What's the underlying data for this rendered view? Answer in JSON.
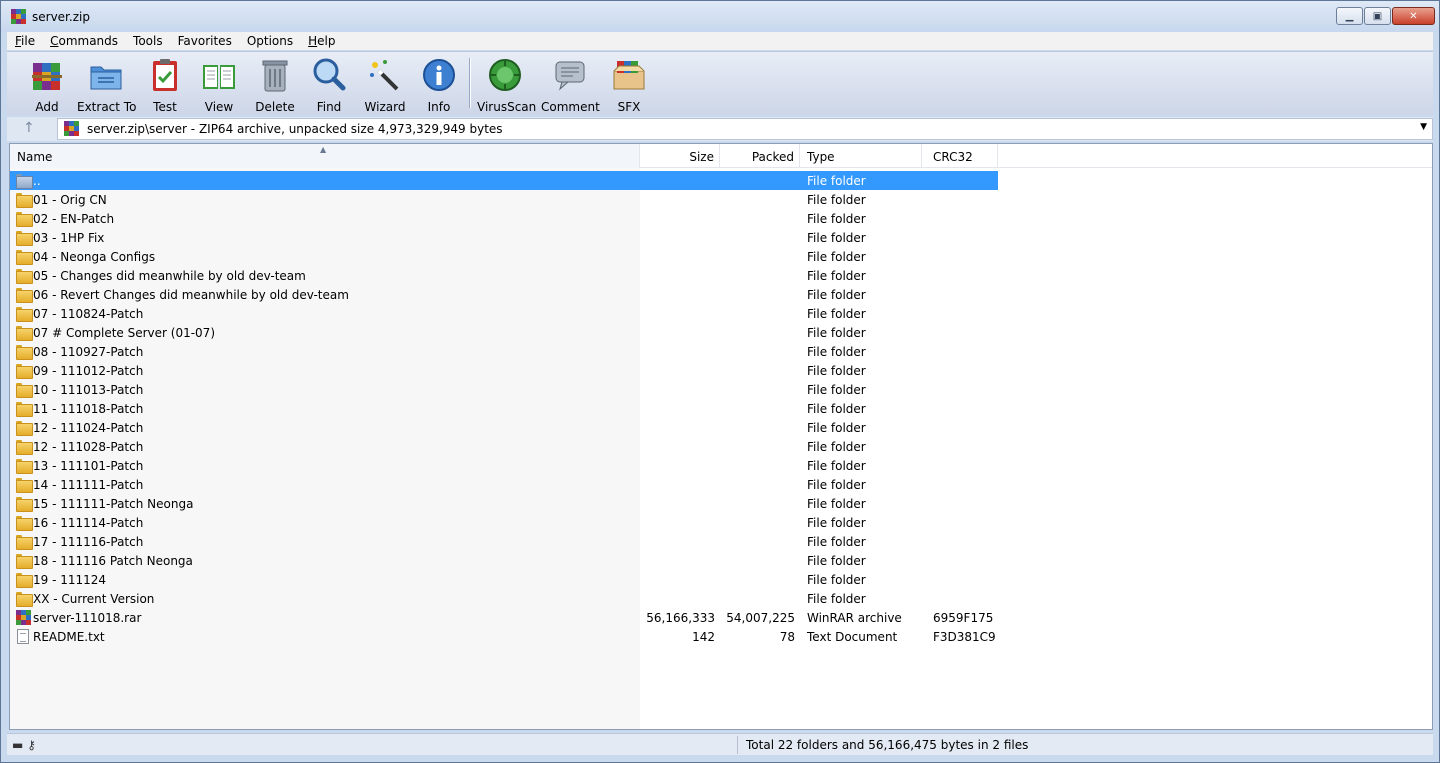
{
  "window": {
    "title": "server.zip"
  },
  "menu": [
    {
      "label": "File",
      "u": "F",
      "rest": "ile"
    },
    {
      "label": "Commands",
      "u": "C",
      "rest": "ommands"
    },
    {
      "label": "Tools",
      "u": "",
      "rest": "Tools"
    },
    {
      "label": "Favorites",
      "u": "",
      "rest": "Favorites"
    },
    {
      "label": "Options",
      "u": "",
      "rest": "Options"
    },
    {
      "label": "Help",
      "u": "H",
      "rest": "elp"
    }
  ],
  "toolbar": {
    "add": "Add",
    "extract": "Extract To",
    "test": "Test",
    "view": "View",
    "delete": "Delete",
    "find": "Find",
    "wizard": "Wizard",
    "info": "Info",
    "virusscan": "VirusScan",
    "comment": "Comment",
    "sfx": "SFX"
  },
  "address": {
    "path": "server.zip\\server - ZIP64 archive, unpacked size 4,973,329,949 bytes"
  },
  "columns": {
    "name": "Name",
    "size": "Size",
    "packed": "Packed",
    "type": "Type",
    "crc": "CRC32"
  },
  "files": [
    {
      "name": "..",
      "size": "",
      "packed": "",
      "type": "File folder",
      "crc": "",
      "icon": "up-folder-icon"
    },
    {
      "name": "01 - Orig CN",
      "size": "",
      "packed": "",
      "type": "File folder",
      "crc": "",
      "icon": "folder-icon"
    },
    {
      "name": "02 - EN-Patch",
      "size": "",
      "packed": "",
      "type": "File folder",
      "crc": "",
      "icon": "folder-icon"
    },
    {
      "name": "03 - 1HP Fix",
      "size": "",
      "packed": "",
      "type": "File folder",
      "crc": "",
      "icon": "folder-icon"
    },
    {
      "name": "04 - Neonga Configs",
      "size": "",
      "packed": "",
      "type": "File folder",
      "crc": "",
      "icon": "folder-icon"
    },
    {
      "name": "05 - Changes did meanwhile by old dev-team",
      "size": "",
      "packed": "",
      "type": "File folder",
      "crc": "",
      "icon": "folder-icon"
    },
    {
      "name": "06 - Revert Changes did meanwhile by old dev-team",
      "size": "",
      "packed": "",
      "type": "File folder",
      "crc": "",
      "icon": "folder-icon"
    },
    {
      "name": "07 - 110824-Patch",
      "size": "",
      "packed": "",
      "type": "File folder",
      "crc": "",
      "icon": "folder-icon"
    },
    {
      "name": "07 # Complete Server (01-07)",
      "size": "",
      "packed": "",
      "type": "File folder",
      "crc": "",
      "icon": "folder-icon"
    },
    {
      "name": "08 - 110927-Patch",
      "size": "",
      "packed": "",
      "type": "File folder",
      "crc": "",
      "icon": "folder-icon"
    },
    {
      "name": "09 - 111012-Patch",
      "size": "",
      "packed": "",
      "type": "File folder",
      "crc": "",
      "icon": "folder-icon"
    },
    {
      "name": "10 - 111013-Patch",
      "size": "",
      "packed": "",
      "type": "File folder",
      "crc": "",
      "icon": "folder-icon"
    },
    {
      "name": "11 - 111018-Patch",
      "size": "",
      "packed": "",
      "type": "File folder",
      "crc": "",
      "icon": "folder-icon"
    },
    {
      "name": "12 - 111024-Patch",
      "size": "",
      "packed": "",
      "type": "File folder",
      "crc": "",
      "icon": "folder-icon"
    },
    {
      "name": "12 - 111028-Patch",
      "size": "",
      "packed": "",
      "type": "File folder",
      "crc": "",
      "icon": "folder-icon"
    },
    {
      "name": "13 - 111101-Patch",
      "size": "",
      "packed": "",
      "type": "File folder",
      "crc": "",
      "icon": "folder-icon"
    },
    {
      "name": "14 - 111111-Patch",
      "size": "",
      "packed": "",
      "type": "File folder",
      "crc": "",
      "icon": "folder-icon"
    },
    {
      "name": "15 - 111111-Patch Neonga",
      "size": "",
      "packed": "",
      "type": "File folder",
      "crc": "",
      "icon": "folder-icon"
    },
    {
      "name": "16 - 111114-Patch",
      "size": "",
      "packed": "",
      "type": "File folder",
      "crc": "",
      "icon": "folder-icon"
    },
    {
      "name": "17 - 111116-Patch",
      "size": "",
      "packed": "",
      "type": "File folder",
      "crc": "",
      "icon": "folder-icon"
    },
    {
      "name": "18 - 111116 Patch Neonga",
      "size": "",
      "packed": "",
      "type": "File folder",
      "crc": "",
      "icon": "folder-icon"
    },
    {
      "name": "19 - 111124",
      "size": "",
      "packed": "",
      "type": "File folder",
      "crc": "",
      "icon": "folder-icon"
    },
    {
      "name": "XX - Current Version",
      "size": "",
      "packed": "",
      "type": "File folder",
      "crc": "",
      "icon": "folder-icon"
    },
    {
      "name": "server-111018.rar",
      "size": "56,166,333",
      "packed": "54,007,225",
      "type": "WinRAR archive",
      "crc": "6959F175",
      "icon": "winrar-archive-icon"
    },
    {
      "name": "README.txt",
      "size": "142",
      "packed": "78",
      "type": "Text Document",
      "crc": "F3D381C9",
      "icon": "text-document-icon"
    }
  ],
  "status": {
    "summary": "Total 22 folders and 56,166,475 bytes in 2 files"
  }
}
